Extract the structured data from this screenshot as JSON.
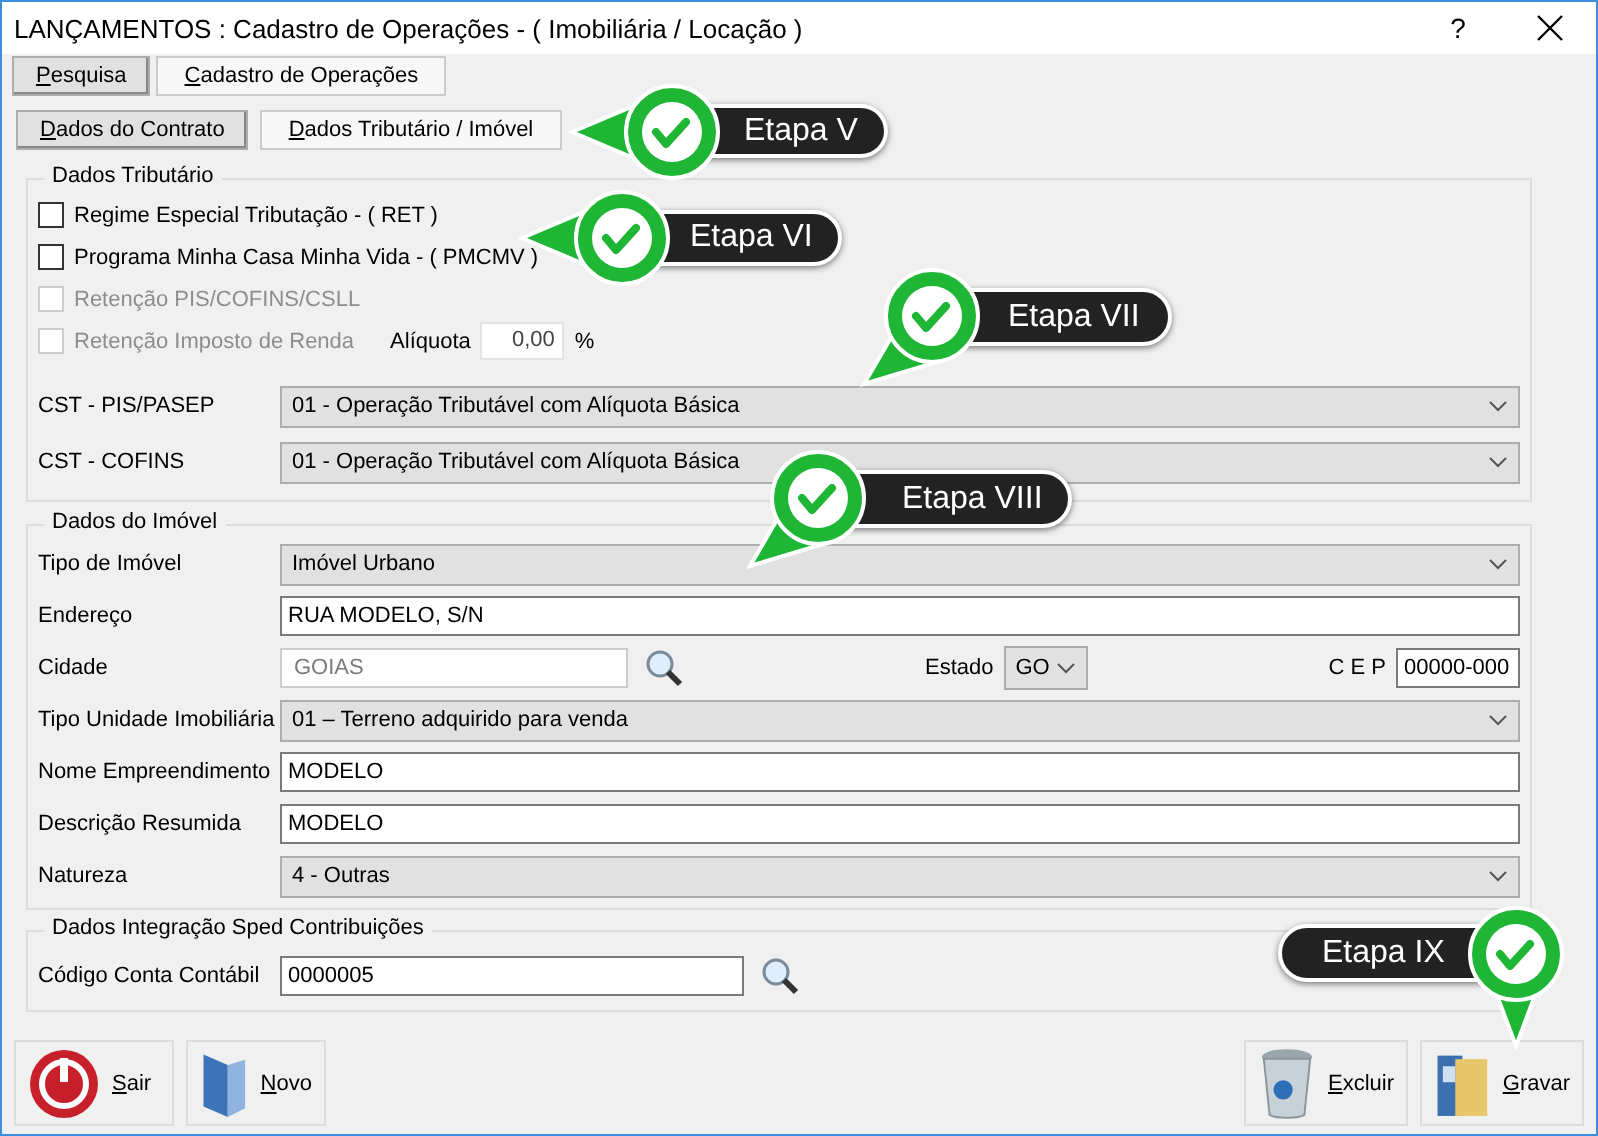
{
  "window": {
    "title": "LANÇAMENTOS : Cadastro de Operações - ( Imobiliária / Locação )",
    "help": "?"
  },
  "main_tabs": [
    {
      "label": "Pesquisa",
      "selected": false
    },
    {
      "label": "Cadastro de Operações",
      "selected": true
    }
  ],
  "sub_tabs": [
    {
      "label": "Dados do Contrato",
      "selected": false
    },
    {
      "label": "Dados Tributário  /  Imóvel",
      "selected": true
    }
  ],
  "tax_group": {
    "title": "Dados Tributário",
    "options": [
      {
        "label": "Regime Especial Tributação - ( RET )",
        "checked": false,
        "disabled": false
      },
      {
        "label": "Programa Minha Casa Minha Vida - ( PMCMV )",
        "checked": false,
        "disabled": false
      },
      {
        "label": "Retenção PIS/COFINS/CSLL",
        "checked": false,
        "disabled": true
      },
      {
        "label": "Retenção Imposto de Renda",
        "checked": false,
        "disabled": true,
        "rate": {
          "label": "Alíquota",
          "value": "0,00",
          "unit": "%"
        }
      }
    ],
    "fields": [
      {
        "label": "CST - PIS/PASEP",
        "value": "01 - Operação Tributável com Alíquota Básica"
      },
      {
        "label": "CST - COFINS",
        "value": "01 - Operação Tributável com Alíquota Básica"
      }
    ]
  },
  "property_group": {
    "title": "Dados do Imóvel",
    "fields": [
      {
        "kind": "select",
        "label": "Tipo de Imóvel",
        "value": "Imóvel Urbano"
      },
      {
        "kind": "text",
        "label": "Endereço",
        "value": "RUA MODELO, S/N"
      },
      {
        "kind": "location",
        "label": "Cidade",
        "value": "GOIAS",
        "disabled": true,
        "state": {
          "label": "Estado",
          "value": "GO"
        },
        "cep": {
          "label": "C E P",
          "value": "00000-000"
        }
      },
      {
        "kind": "select",
        "label": "Tipo Unidade Imobiliária",
        "value": "01 – Terreno adquirido para venda"
      },
      {
        "kind": "text",
        "label": "Nome Empreendimento",
        "value": "MODELO"
      },
      {
        "kind": "text",
        "label": "Descrição Resumida",
        "value": "MODELO"
      },
      {
        "kind": "select",
        "label": "Natureza",
        "value": "4 - Outras"
      }
    ]
  },
  "sped_group": {
    "title": "Dados Integração Sped Contribuições",
    "field": {
      "label": "Código Conta Contábil",
      "value": "0000005"
    }
  },
  "buttons": [
    {
      "kind": "exit",
      "label": "Sair"
    },
    {
      "kind": "new",
      "label": "Novo"
    },
    {
      "kind": "delete",
      "label": "Excluir"
    },
    {
      "kind": "save",
      "label": "Gravar"
    }
  ],
  "callouts": [
    {
      "kind": "left",
      "label": "Etapa V"
    },
    {
      "kind": "left",
      "label": "Etapa VI"
    },
    {
      "kind": "down-left",
      "label": "Etapa VII"
    },
    {
      "kind": "down-left",
      "label": "Etapa VIII"
    },
    {
      "kind": "down",
      "label": "Etapa IX"
    }
  ]
}
